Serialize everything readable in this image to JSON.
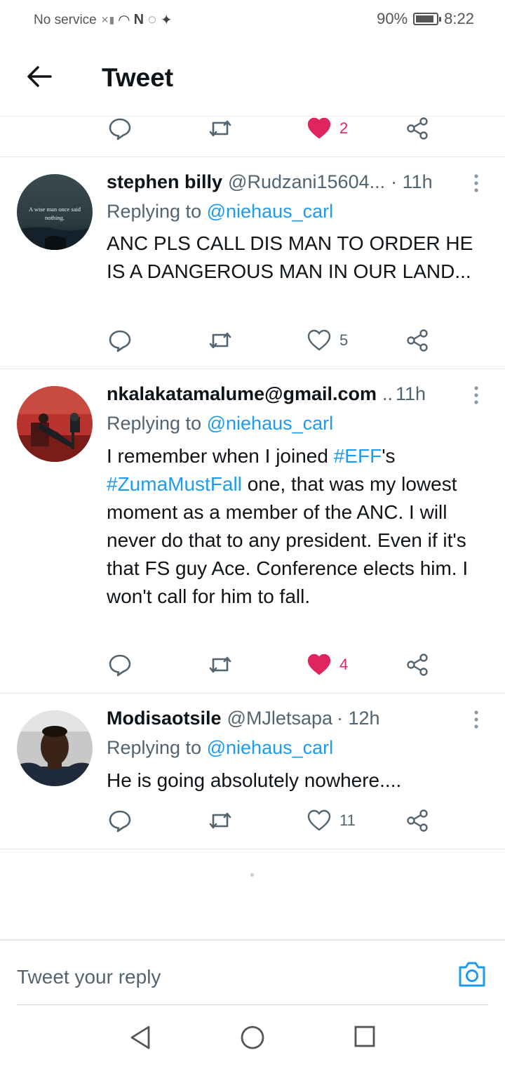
{
  "status_bar": {
    "carrier": "No service",
    "battery_percent": "90%",
    "battery_level": 0.9,
    "time": "8:22"
  },
  "header": {
    "title": "Tweet"
  },
  "colors": {
    "link": "#1d9bf0",
    "liked": "#e0245e",
    "icon": "#536471"
  },
  "top_actions": {
    "like_count": "2",
    "liked": true
  },
  "tweets": [
    {
      "name": "stephen billy",
      "handle": "@Rudzani15604...",
      "time": "· 11h",
      "replying_prefix": "Replying to",
      "replying_to": "@niehaus_carl",
      "text": "ANC PLS CALL DIS MAN TO ORDER HE IS A DANGEROUS MAN IN OUR LAND...",
      "avatar_text": "A wise man once said nothing.",
      "like_count": "5",
      "liked": false
    },
    {
      "name": "nkalakatamalume@gmail.com",
      "handle": "..",
      "time": "11h",
      "replying_prefix": "Replying to",
      "replying_to": "@niehaus_carl",
      "text_parts": [
        "I remember when I joined ",
        "#EFF",
        "'s ",
        "#ZumaMustFall",
        " one, that was my lowest moment as a member of the ANC. I will never do that to any president. Even if it's that FS guy Ace. Conference elects him. I won't call for him to fall."
      ],
      "like_count": "4",
      "liked": true
    },
    {
      "name": "Modisaotsile",
      "handle": "@MJletsapa",
      "time": "· 12h",
      "replying_prefix": "Replying to",
      "replying_to": "@niehaus_carl",
      "text": "He is going absolutely nowhere....",
      "like_count": "11",
      "liked": false
    }
  ],
  "reply_bar": {
    "placeholder": "Tweet your reply"
  },
  "icons": {
    "back": "arrow-left-icon",
    "reply": "speech-bubble-icon",
    "retweet": "retweet-icon",
    "like": "heart-icon",
    "share": "share-icon",
    "more": "three-dots-vertical-icon",
    "camera": "camera-icon"
  }
}
